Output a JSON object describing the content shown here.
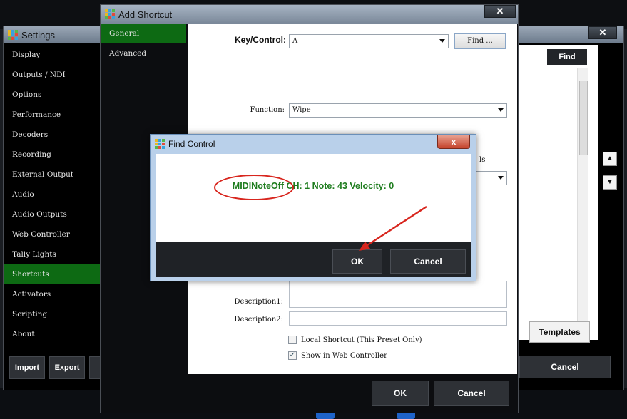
{
  "settings": {
    "title": "Settings",
    "nav": [
      "Display",
      "Outputs / NDI",
      "Options",
      "Performance",
      "Decoders",
      "Recording",
      "External Output",
      "Audio",
      "Audio Outputs",
      "Web Controller",
      "Tally Lights",
      "Shortcuts",
      "Activators",
      "Scripting",
      "About"
    ],
    "active_index": 11,
    "buttons": {
      "import": "Import",
      "export": "Export"
    }
  },
  "shortcuts_window": {
    "find_label": "Find",
    "templates_label": "Templates",
    "cancel_label": "Cancel"
  },
  "add_shortcut": {
    "title": "Add Shortcut",
    "nav": [
      "General",
      "Advanced"
    ],
    "active_index": 0,
    "key_label": "Key/Control:",
    "key_value": "A",
    "find_button": "Find ...",
    "function_label": "Function:",
    "function_value": "Wipe",
    "partial_label_right": "ls",
    "description1_label": "Description1:",
    "description2_label": "Description2:",
    "local_shortcut_label": "Local Shortcut (This Preset Only)",
    "local_shortcut_checked": false,
    "show_in_web_label": "Show in Web Controller",
    "show_in_web_checked": true,
    "ok_label": "OK",
    "cancel_label": "Cancel"
  },
  "find_control": {
    "title": "Find Control",
    "message": "MIDINoteOff CH: 1 Note: 43 Velocity: 0",
    "ok_label": "OK",
    "cancel_label": "Cancel",
    "close_glyph": "x"
  },
  "colors": {
    "active_nav": "#0d6a13",
    "message_green": "#1f7d1f",
    "annotation_red": "#d8261e",
    "button_dark": "#2e3136"
  },
  "logo_colors": [
    "#e8b723",
    "#36a3df",
    "#55b84a",
    "#e8b723",
    "#36a3df",
    "#e24a3a",
    "#55b84a",
    "#e24a3a",
    "#36a3df"
  ]
}
